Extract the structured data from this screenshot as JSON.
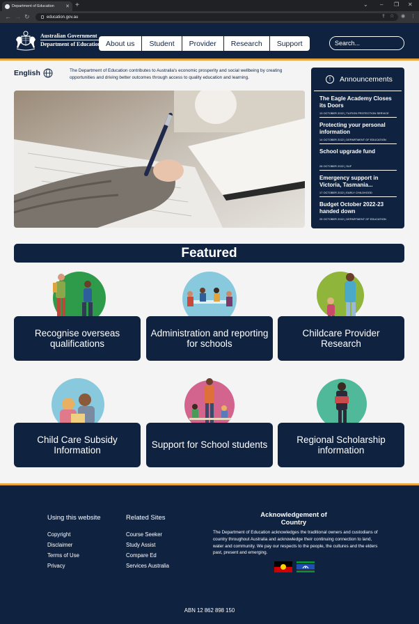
{
  "browser": {
    "tab_title": "Department of Education",
    "url": "education.gov.au"
  },
  "header": {
    "logo_line1": "Australian Government",
    "logo_line2": "Department of Education",
    "nav": [
      "About us",
      "Student",
      "Provider",
      "Research",
      "Support"
    ],
    "search_placeholder": "Search..."
  },
  "intro": {
    "language": "English",
    "text": "The Department of Education contributes to Australia's economic prosperity and social wellbeing by creating opportunities and driving better outcomes through access to quality education and learning."
  },
  "announcements": {
    "title": "Announcements",
    "items": [
      {
        "title": "The Eagle Academy Closes its Doors",
        "meta": "13 OCTOBER 2022 | TUITION PROTECTION SERVICE"
      },
      {
        "title": "Protecting your personal information",
        "meta": "14 OCTOBER 2022 | DEPARTMENT OF EDUCATION"
      },
      {
        "title": "School upgrade fund",
        "meta": "28 OCTOBER 2022 | SUF"
      },
      {
        "title": "Emergency support in Victoria, Tasmania...",
        "meta": "17 OCTOBER 2022 | EARLY CHILDHOOD"
      },
      {
        "title": "Budget October 2022-23 handed down",
        "meta": "25 OCTOBER 2022 | DEPARTMENT OF EDUCATION"
      }
    ]
  },
  "featured": {
    "title": "Featured",
    "cards": [
      "Recognise overseas qualifications",
      "Administration and reporting for schools",
      "Childcare Provider Research",
      "Child Care Subsidy Information",
      "Support for School students",
      "Regional Scholarship information"
    ]
  },
  "footer": {
    "using_title": "Using this website",
    "using_links": [
      "Copyright",
      "Disclaimer",
      "Terms of Use",
      "Privacy"
    ],
    "related_title": "Related Sites",
    "related_links": [
      "Course Seeker",
      "Study Assist",
      "Compare Ed",
      "Services Australia"
    ],
    "ack_title": "Acknowledgement of Country",
    "ack_text": "The Department of Education acknowledges the traditional owners and custodians of country throughout Australia and acknowledge their continuing connection to land, water and community. We pay our respects to the people, the cultures and the elders past, present and emerging.",
    "abn": "ABN 12 862 898 150"
  },
  "colors": {
    "navy": "#0f2240",
    "accent": "#e8a33d",
    "circle_green": "#2e9b4a",
    "circle_blue": "#89c9dd",
    "circle_olive": "#8fb53a",
    "circle_pink": "#d2648e",
    "circle_teal": "#4fb99a"
  }
}
